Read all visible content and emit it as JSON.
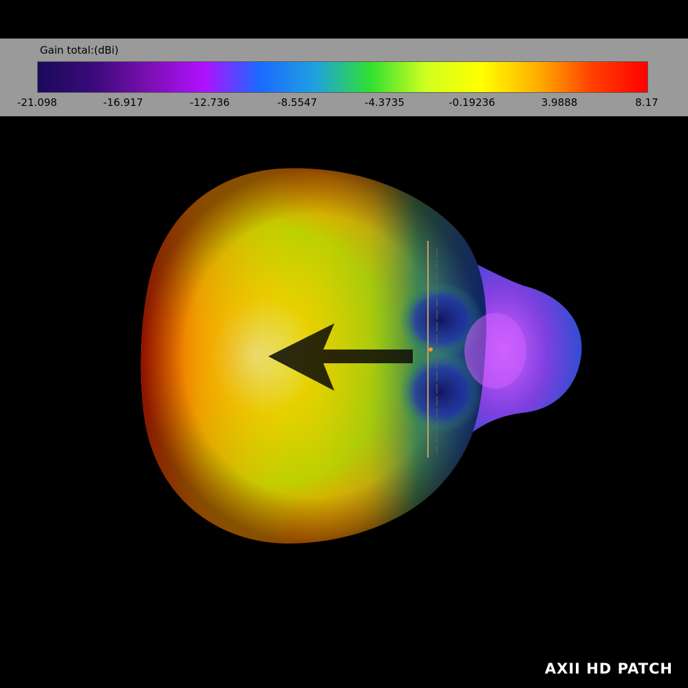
{
  "colorbar": {
    "title": "Gain total:(dBi)",
    "ticks": [
      "-21.098",
      "-16.917",
      "-12.736",
      "-8.5547",
      "-4.3735",
      "-0.19236",
      "3.9888",
      "8.17"
    ],
    "colors": [
      "#1a0a5a",
      "#3a0a7a",
      "#7a10b0",
      "#b010ff",
      "#1a6aff",
      "#20a0e0",
      "#30e030",
      "#d0ff20",
      "#ffff00",
      "#ffb000",
      "#ff4000",
      "#ff0000"
    ]
  },
  "pattern": {
    "main_lobe_colors": [
      "#ff1a00",
      "#ff8000",
      "#e8d000",
      "#bcd000",
      "#30a030",
      "#1a40c0"
    ],
    "back_lobe_colors": [
      "#d060ff",
      "#8040e0",
      "#2050d0"
    ],
    "arrow_color": "#111008"
  },
  "brand": {
    "text": "AXII HD PATCH"
  }
}
